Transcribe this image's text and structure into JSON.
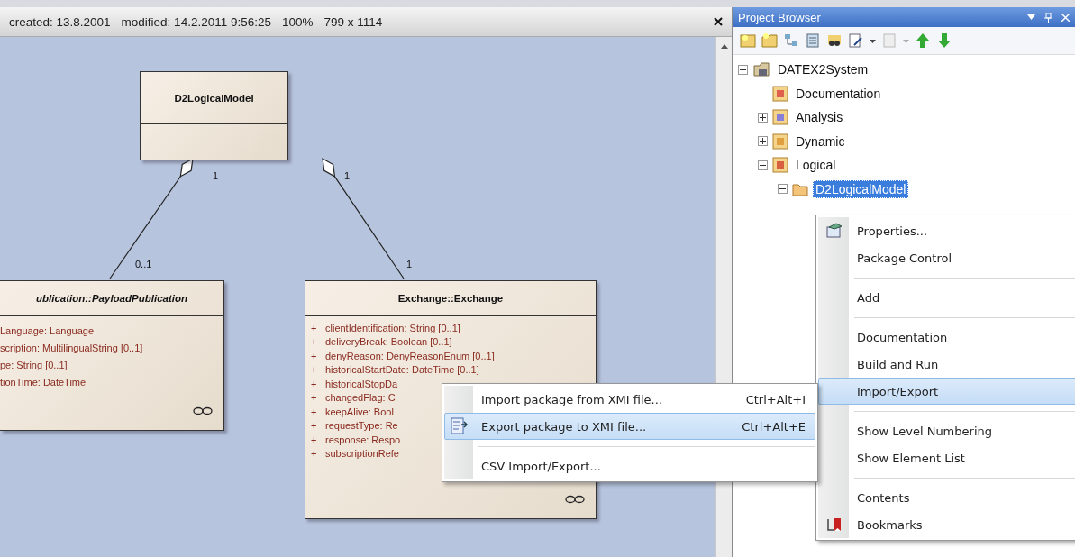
{
  "document_header": {
    "created": "created: 13.8.2001",
    "modified": "modified: 14.2.2011 9:56:25",
    "zoom": "100%",
    "size": "799 x 1114"
  },
  "diagram": {
    "classes": [
      {
        "name": "D2LogicalModel",
        "abstract": false
      },
      {
        "name": "ublication::PayloadPublication",
        "abstract": true,
        "attributes": [
          {
            "text": "Language: Language"
          },
          {
            "text": "scription: MultilingualString [0..1]"
          },
          {
            "text": "pe: String [0..1]"
          },
          {
            "text": "tionTime: DateTime"
          }
        ]
      },
      {
        "name": "Exchange::Exchange",
        "abstract": false,
        "attributes": [
          {
            "visibility": "+",
            "text": "clientIdentification: String [0..1]"
          },
          {
            "visibility": "+",
            "text": "deliveryBreak: Boolean [0..1]"
          },
          {
            "visibility": "+",
            "text": "denyReason: DenyReasonEnum [0..1]"
          },
          {
            "visibility": "+",
            "text": "historicalStartDate: DateTime [0..1]"
          },
          {
            "visibility": "+",
            "text": "historicalStopDa"
          },
          {
            "visibility": "+",
            "text": "changedFlag: C"
          },
          {
            "visibility": "+",
            "text": "keepAlive: Bool"
          },
          {
            "visibility": "+",
            "text": "requestType: Re"
          },
          {
            "visibility": "+",
            "text": "response: Respo"
          },
          {
            "visibility": "+",
            "text": "subscriptionRefe"
          }
        ]
      }
    ],
    "connectors": [
      {
        "kind": "aggregation",
        "whole_multiplicity": "1",
        "part_multiplicity": "0..1"
      },
      {
        "kind": "aggregation",
        "whole_multiplicity": "1",
        "part_multiplicity": "1"
      }
    ]
  },
  "project_browser": {
    "title": "Project Browser",
    "tree": [
      {
        "label": "DATEX2System",
        "kind": "root",
        "expanded": true,
        "selected": false,
        "children": [
          {
            "label": "Documentation",
            "kind": "documentation",
            "selected": false
          },
          {
            "label": "Analysis",
            "kind": "analysis",
            "expanded": false,
            "selected": false
          },
          {
            "label": "Dynamic",
            "kind": "dynamic",
            "expanded": false,
            "selected": false
          },
          {
            "label": "Logical",
            "kind": "logical",
            "expanded": true,
            "selected": false,
            "children": [
              {
                "label": "D2LogicalModel",
                "kind": "folder",
                "expanded": true,
                "selected": true
              }
            ]
          }
        ]
      }
    ]
  },
  "context_menu": [
    {
      "kind": "properties",
      "label": "Properties...",
      "selected": false
    },
    {
      "kind": "item",
      "label": "Package Control",
      "selected": false
    },
    {
      "kind": "separator"
    },
    {
      "kind": "item",
      "label": "Add",
      "selected": false
    },
    {
      "kind": "separator"
    },
    {
      "kind": "item",
      "label": "Documentation",
      "selected": false
    },
    {
      "kind": "item",
      "label": "Build and Run",
      "selected": false
    },
    {
      "kind": "item",
      "label": "Import/Export",
      "selected": true
    },
    {
      "kind": "separator"
    },
    {
      "kind": "item",
      "label": "Show Level Numbering",
      "selected": false
    },
    {
      "kind": "item",
      "label": "Show Element List",
      "selected": false
    },
    {
      "kind": "separator"
    },
    {
      "kind": "item",
      "label": "Contents",
      "selected": false
    },
    {
      "kind": "bookmarks",
      "label": "Bookmarks",
      "selected": false
    }
  ],
  "submenu": [
    {
      "kind": "item",
      "label": "Import package from XMI file...",
      "shortcut": "Ctrl+Alt+I",
      "selected": false
    },
    {
      "kind": "export",
      "label": "Export package to XMI file...",
      "shortcut": "Ctrl+Alt+E",
      "selected": true
    },
    {
      "kind": "separator"
    },
    {
      "kind": "item",
      "label": "CSV Import/Export...",
      "selected": false
    }
  ]
}
